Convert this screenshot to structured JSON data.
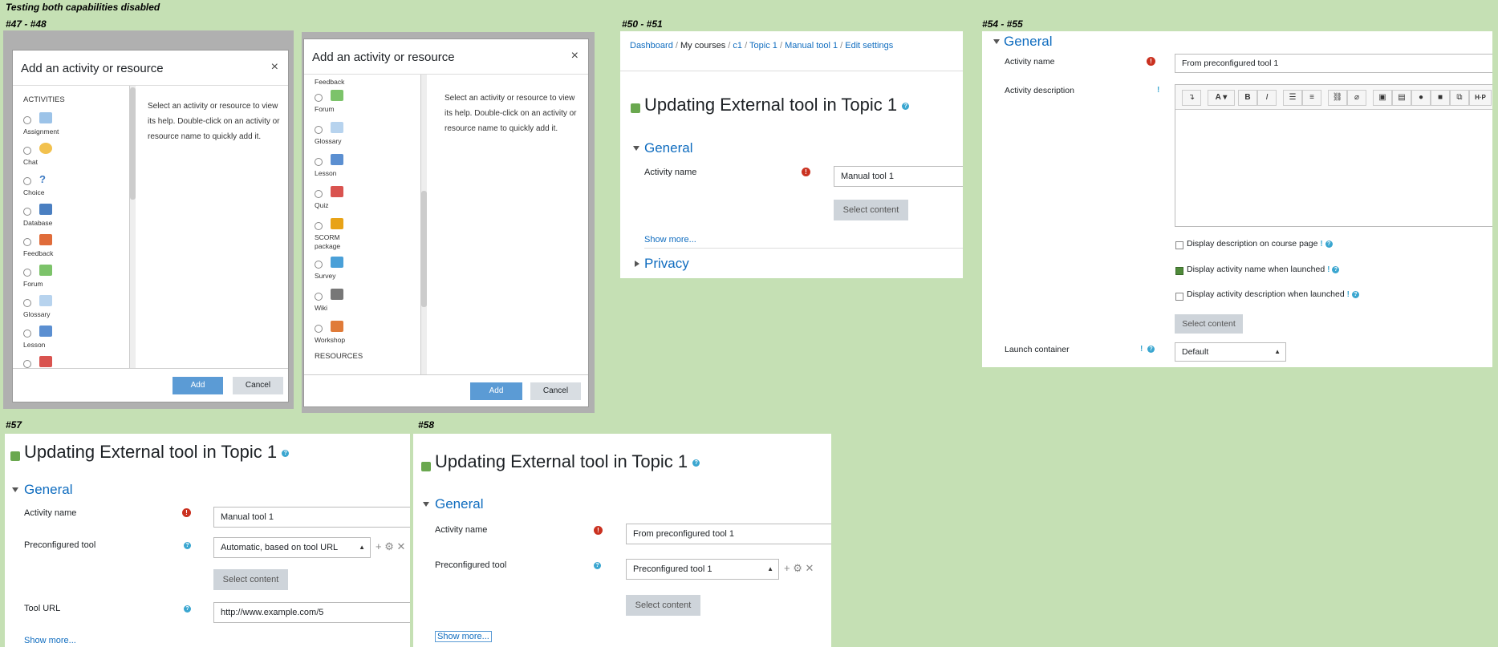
{
  "title": "Testing both capabilities disabled",
  "labels": {
    "s47": "#47 - #48",
    "s50": "#50 - #51",
    "s54": "#54 - #55",
    "s57": "#57",
    "s58": "#58"
  },
  "modal": {
    "title": "Add an activity or resource",
    "close": "×",
    "section_activities": "ACTIVITIES",
    "section_resources": "RESOURCES",
    "help": "Select an activity or resource to view its help. Double-click on an activity or resource name to quickly add it.",
    "add": "Add",
    "cancel": "Cancel",
    "list1": [
      "Assignment",
      "Chat",
      "Choice",
      "Database",
      "Feedback",
      "Forum",
      "Glossary",
      "Lesson"
    ],
    "list2": [
      "Feedback",
      "Forum",
      "Glossary",
      "Lesson",
      "Quiz",
      "SCORM package",
      "Survey",
      "Wiki",
      "Workshop"
    ]
  },
  "breadcrumb": [
    "Dashboard",
    "My courses",
    "c1",
    "Topic 1",
    "Manual tool 1",
    "Edit settings"
  ],
  "form": {
    "heading": "Updating External tool in Topic 1",
    "general": "General",
    "privacy": "Privacy",
    "activity_name": "Activity name",
    "activity_description": "Activity description",
    "preconfigured_tool": "Preconfigured tool",
    "tool_url": "Tool URL",
    "launch_container": "Launch container",
    "select_content": "Select content",
    "show_more": "Show more...",
    "name_manual": "Manual tool 1",
    "name_preconf": "From preconfigured tool 1",
    "sel_auto": "Automatic, based on tool URL",
    "sel_preconf": "Preconfigured tool 1",
    "url_value": "http://www.example.com/5",
    "launch_default": "Default",
    "chk_desc": "Display description on course page",
    "chk_name": "Display activity name when launched",
    "chk_actdesc": "Display activity description when launched",
    "tools_icons": "+ ⚙ ✕"
  },
  "colors": {
    "accent": "#0f6cbf",
    "required": "#ca3120",
    "help": "#3aa6d0",
    "background": "#c5e0b4"
  }
}
